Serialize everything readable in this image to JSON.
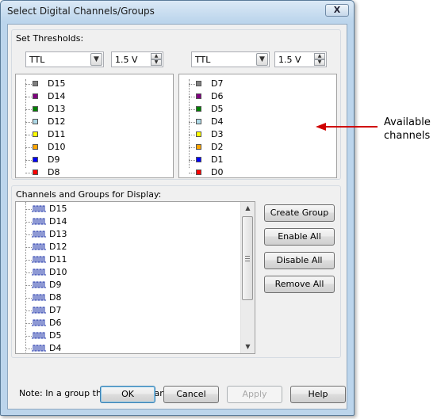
{
  "window": {
    "title": "Select Digital Channels/Groups",
    "close_label": "X"
  },
  "thresholds": {
    "group_label": "Set Thresholds:",
    "left": {
      "family": "TTL",
      "voltage": "1.5 V"
    },
    "right": {
      "family": "TTL",
      "voltage": "1.5 V"
    }
  },
  "available": {
    "left": [
      {
        "label": "D15",
        "color": "#808080"
      },
      {
        "label": "D14",
        "color": "#800080"
      },
      {
        "label": "D13",
        "color": "#008000"
      },
      {
        "label": "D12",
        "color": "#add8e6"
      },
      {
        "label": "D11",
        "color": "#ffff00"
      },
      {
        "label": "D10",
        "color": "#ffa500"
      },
      {
        "label": "D9",
        "color": "#0000ff"
      },
      {
        "label": "D8",
        "color": "#ff0000"
      }
    ],
    "right": [
      {
        "label": "D7",
        "color": "#808080"
      },
      {
        "label": "D6",
        "color": "#800080"
      },
      {
        "label": "D5",
        "color": "#008000"
      },
      {
        "label": "D4",
        "color": "#add8e6"
      },
      {
        "label": "D3",
        "color": "#ffff00"
      },
      {
        "label": "D2",
        "color": "#ffa500"
      },
      {
        "label": "D1",
        "color": "#0000ff"
      },
      {
        "label": "D0",
        "color": "#ff0000"
      }
    ]
  },
  "display": {
    "group_label": "Channels and Groups for Display:",
    "items": [
      "D15",
      "D14",
      "D13",
      "D12",
      "D11",
      "D10",
      "D9",
      "D8",
      "D7",
      "D6",
      "D5",
      "D4"
    ],
    "buttons": {
      "create_group": "Create Group",
      "enable_all": "Enable All",
      "disable_all": "Disable All",
      "remove_all": "Remove All"
    }
  },
  "note": "Note: In a group the bottom channel is LSB",
  "footer": {
    "ok": "OK",
    "cancel": "Cancel",
    "apply": "Apply",
    "help": "Help"
  },
  "annotation": {
    "line1": "Available",
    "line2": "channels",
    "arrow_color": "#d00000"
  }
}
